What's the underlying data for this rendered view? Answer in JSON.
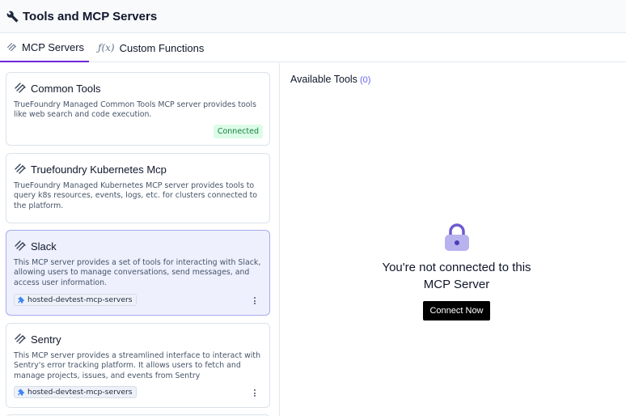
{
  "header": {
    "title": "Tools and MCP Servers",
    "icon": "wrench-icon"
  },
  "tabs": [
    {
      "label": "MCP Servers",
      "icon": "mcp-icon",
      "active": true
    },
    {
      "label": "Custom Functions",
      "icon": "fx-icon",
      "icon_text": "ƒ(x)",
      "active": false
    }
  ],
  "servers": [
    {
      "title": "Common Tools",
      "description": "TrueFoundry Managed Common Tools MCP server provides tools like web search and code execution.",
      "status": "Connected"
    },
    {
      "title": "Truefoundry Kubernetes Mcp",
      "description": "TrueFoundry Managed Kubernetes MCP server provides tools to query k8s resources, events, logs, etc. for clusters connected to the platform."
    },
    {
      "title": "Slack",
      "description": "This MCP server provides a set of tools for interacting with Slack, allowing users to manage conversations, send messages, and access user information.",
      "tag": "hosted-devtest-mcp-servers",
      "selected": true
    },
    {
      "title": "Sentry",
      "description": "This MCP server provides a streamlined interface to interact with Sentry's error tracking platform. It allows users to fetch and manage projects, issues, and events from Sentry",
      "tag": "hosted-devtest-mcp-servers"
    }
  ],
  "right": {
    "available_label": "Available Tools",
    "available_count": "(0)",
    "empty_message": "You're not connected to this MCP Server",
    "connect_label": "Connect Now"
  },
  "colors": {
    "accent": "#6d28d9",
    "selected_bg": "#eef0fd",
    "connected": "#15803d",
    "lock": "#6d5bd0"
  }
}
